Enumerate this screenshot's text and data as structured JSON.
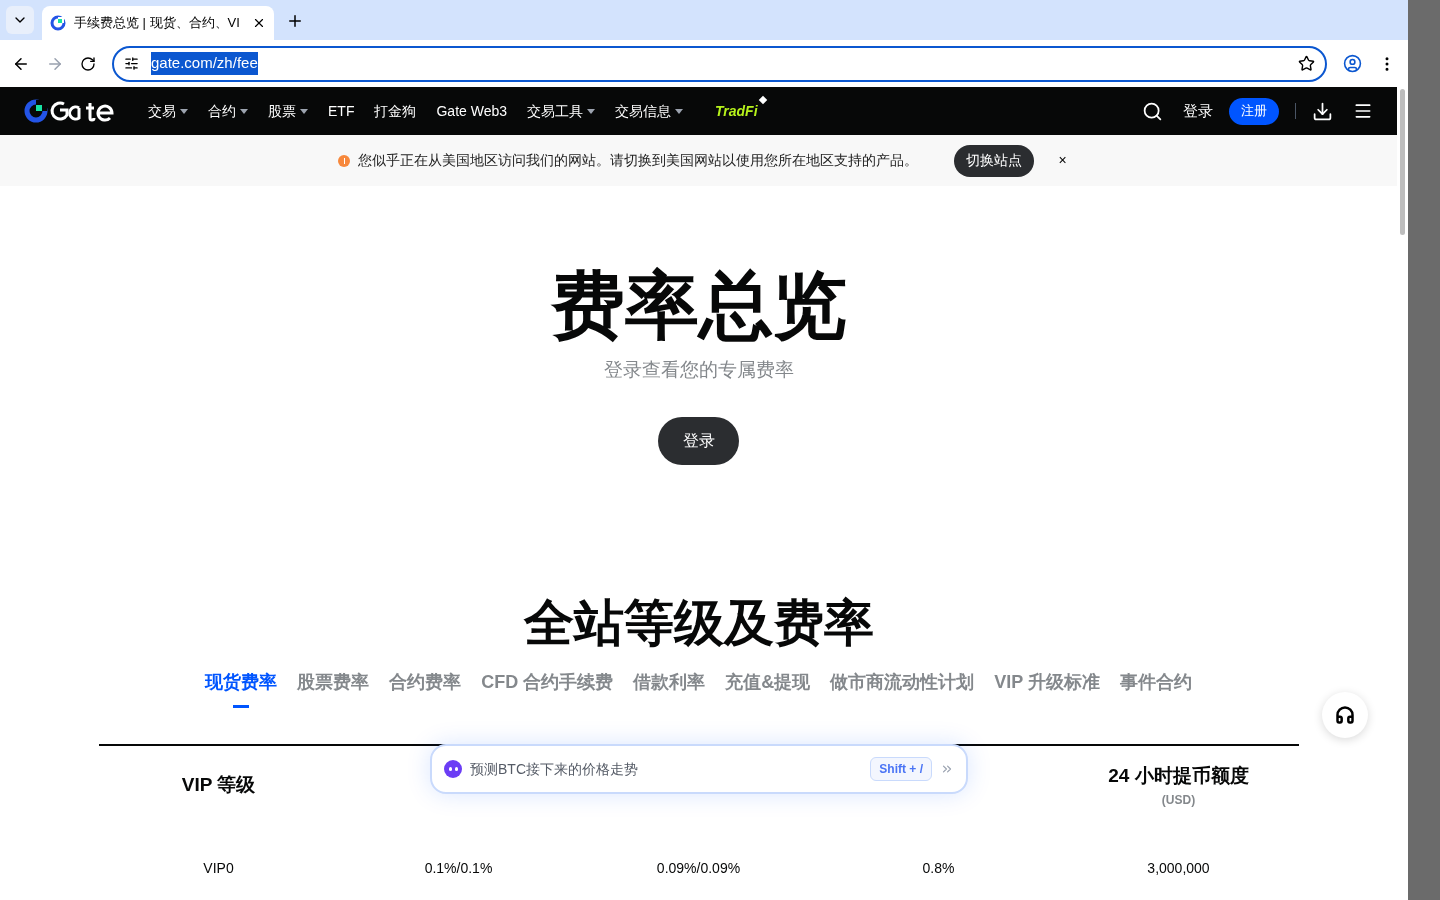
{
  "browser": {
    "tab_title": "手续费总览 | 现货、合约、VI",
    "url": "gate.com/zh/fee"
  },
  "nav": {
    "items": [
      {
        "label": "交易",
        "dropdown": true
      },
      {
        "label": "合约",
        "dropdown": true
      },
      {
        "label": "股票",
        "dropdown": true
      },
      {
        "label": "ETF",
        "dropdown": false
      },
      {
        "label": "打金狗",
        "dropdown": false
      },
      {
        "label": "Gate Web3",
        "dropdown": false
      },
      {
        "label": "交易工具",
        "dropdown": true
      },
      {
        "label": "交易信息",
        "dropdown": true
      }
    ],
    "tradfi": "TradFi",
    "login": "登录",
    "signup": "注册"
  },
  "banner": {
    "message": "您似乎正在从美国地区访问我们的网站。请切换到美国网站以使用您所在地区支持的产品。",
    "button": "切换站点",
    "close": "×"
  },
  "hero": {
    "title": "费率总览",
    "subtitle": "登录查看您的专属费率",
    "button": "登录"
  },
  "section": {
    "title": "全站等级及费率",
    "tabs": [
      {
        "label": "现货费率",
        "selected": true
      },
      {
        "label": "股票费率",
        "selected": false
      },
      {
        "label": "合约费率",
        "selected": false
      },
      {
        "label": "CFD 合约手续费",
        "selected": false
      },
      {
        "label": "借款利率",
        "selected": false
      },
      {
        "label": "充值&提现",
        "selected": false
      },
      {
        "label": "做市商流动性计划",
        "selected": false
      },
      {
        "label": "VIP 升级标准",
        "selected": false
      },
      {
        "label": "事件合约",
        "selected": false
      }
    ]
  },
  "table": {
    "columns": [
      {
        "label": "VIP 等级"
      },
      {},
      {},
      {},
      {
        "label": "24 小时提币额度",
        "sublabel": "(USD)"
      }
    ],
    "rows": [
      [
        "VIP0",
        "0.1%/0.1%",
        "0.09%/0.09%",
        "0.8%",
        "3,000,000"
      ]
    ]
  },
  "assistant": {
    "prompt": "预测BTC接下来的价格走势",
    "shortcut": "Shift + /"
  }
}
